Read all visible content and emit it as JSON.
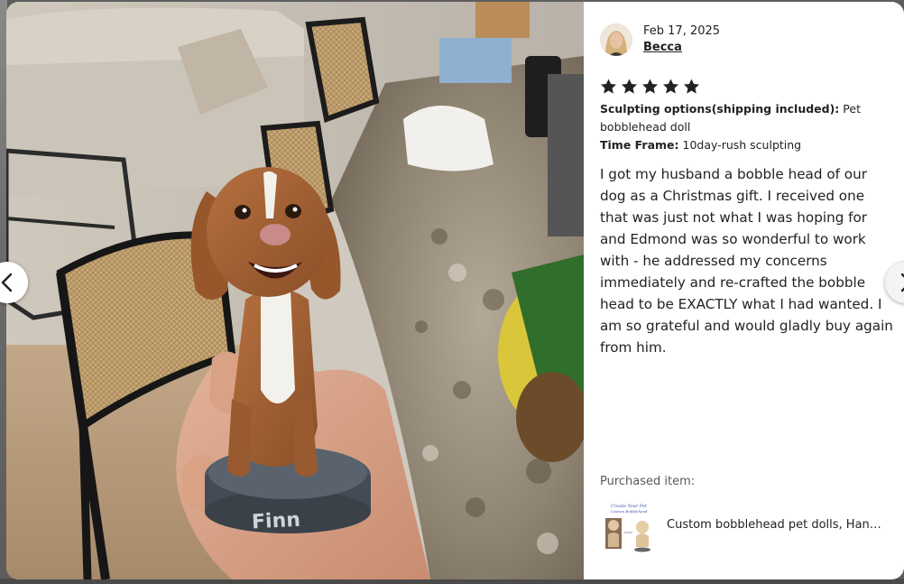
{
  "review": {
    "date": "Feb 17, 2025",
    "reviewer": "Becca",
    "rating": 5,
    "rating_max": 5,
    "attributes": [
      {
        "label": "Sculpting options(shipping included):",
        "value": "Pet bobblehead doll"
      },
      {
        "label": "Time Frame:",
        "value": "10day-rush sculpting"
      }
    ],
    "text": "I got my husband a bobble head of our dog as a Christmas gift. I received one that was just not what I was hoping for and Edmond was so wonderful to work with - he addressed my concerns immediately and re-crafted the bobble head to be EXACTLY what I had wanted. I am so grateful and would gladly buy again from him."
  },
  "photo": {
    "base_name_text": "Finn"
  },
  "purchased": {
    "label": "Purchased item:",
    "title": "Custom bobblehead pet dolls, Handmade custom pet figurine",
    "thumb_text": "Create Your Pet Custom Bobblehead"
  },
  "nav": {
    "prev_icon": "chevron-left-icon",
    "next_icon": "chevron-right-icon"
  },
  "colors": {
    "star": "#222222",
    "link": "#222222"
  }
}
